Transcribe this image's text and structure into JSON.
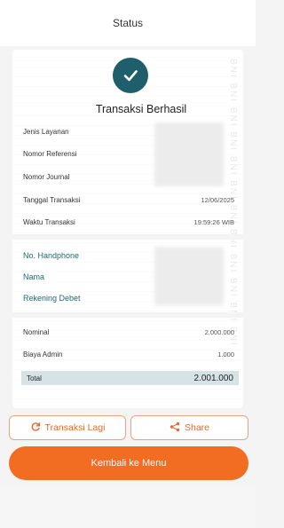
{
  "header": {
    "title": "Status"
  },
  "receipt": {
    "status_title": "Transaksi Berhasil",
    "watermark": "BNI BNI BNI BNI BNI BNI BNI BNI BNI BNI BNI BNI",
    "details": [
      {
        "label": "Jenis Layanan",
        "value": ""
      },
      {
        "label": "Nomor Referensi",
        "value": ""
      },
      {
        "label": "Nomor Journal",
        "value": ""
      },
      {
        "label": "Tanggal Transaksi",
        "value": "12/06/2025"
      },
      {
        "label": "Waktu Transaksi",
        "value": "19:59:26 WIB"
      }
    ],
    "account": [
      {
        "label": "No. Handphone",
        "value": ""
      },
      {
        "label": "Nama",
        "value": ""
      },
      {
        "label": "Rekening Debet",
        "value": ""
      }
    ],
    "amounts": [
      {
        "label": "Nominal",
        "value": "2.000.000"
      },
      {
        "label": "Biaya Admin",
        "value": "1.000"
      }
    ],
    "total": {
      "label": "Total",
      "value": "2.001.000"
    }
  },
  "actions": {
    "repeat_label": "Transaksi Lagi",
    "share_label": "Share",
    "back_label": "Kembali ke Menu"
  },
  "colors": {
    "accent": "#f26c22",
    "teal": "#1f5f6b",
    "total_bg": "#d5e2e6"
  }
}
